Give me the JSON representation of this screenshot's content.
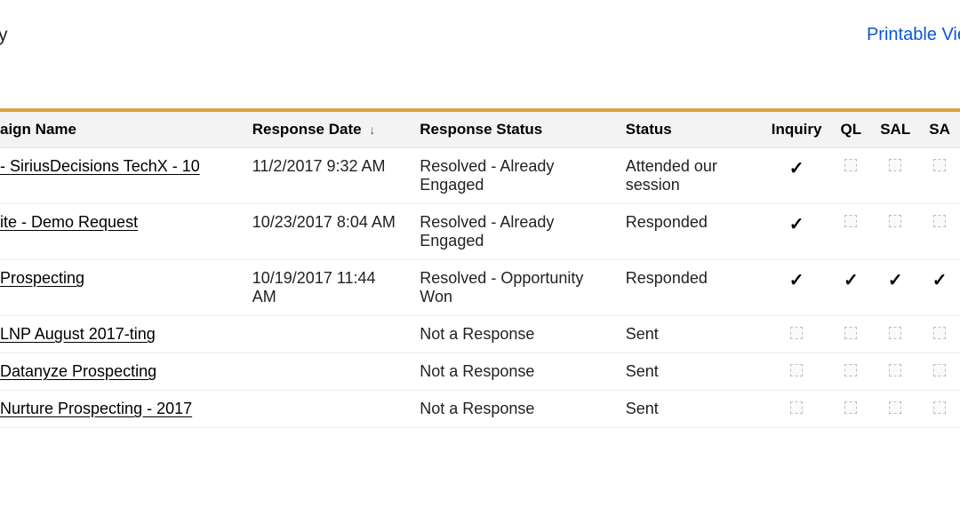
{
  "header": {
    "title_fragment": "y",
    "printable_view": "Printable Vie"
  },
  "table": {
    "columns": {
      "campaign": "aign Name",
      "response_date": "Response Date",
      "response_status": "Response Status",
      "status": "Status",
      "inquiry": "Inquiry",
      "ql": "QL",
      "sal": "SAL",
      "sa": "SA"
    },
    "sort_indicator": "↓",
    "rows": [
      {
        "campaign": " - SiriusDecisions TechX - 10",
        "response_date": "11/2/2017 9:32 AM",
        "response_status": "Resolved - Already Engaged",
        "status": "Attended our session",
        "inquiry": true,
        "ql": false,
        "sal": false,
        "sa": false
      },
      {
        "campaign": "ite - Demo Request",
        "response_date": "10/23/2017 8:04 AM",
        "response_status": "Resolved - Already Engaged",
        "status": "Responded",
        "inquiry": true,
        "ql": false,
        "sal": false,
        "sa": false
      },
      {
        "campaign": "Prospecting",
        "response_date": "10/19/2017 11:44 AM",
        "response_status": "Resolved - Opportunity Won",
        "status": "Responded",
        "inquiry": true,
        "ql": true,
        "sal": true,
        "sa": true
      },
      {
        "campaign": "LNP August 2017-ting",
        "response_date": "",
        "response_status": "Not a Response",
        "status": "Sent",
        "inquiry": false,
        "ql": false,
        "sal": false,
        "sa": false
      },
      {
        "campaign": "Datanyze Prospecting",
        "response_date": "",
        "response_status": "Not a Response",
        "status": "Sent",
        "inquiry": false,
        "ql": false,
        "sal": false,
        "sa": false
      },
      {
        "campaign": "Nurture Prospecting - 2017",
        "response_date": "",
        "response_status": "Not a Response",
        "status": "Sent",
        "inquiry": false,
        "ql": false,
        "sal": false,
        "sa": false
      }
    ]
  }
}
